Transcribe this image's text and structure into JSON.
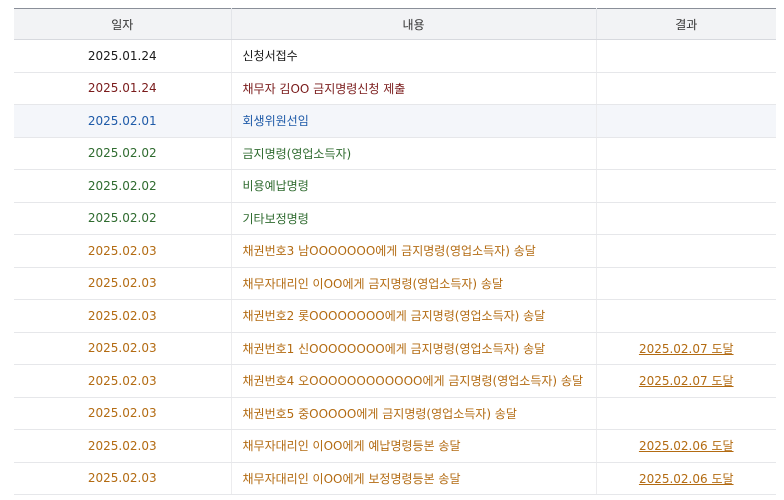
{
  "table": {
    "headers": {
      "date": "일자",
      "content": "내용",
      "result": "결과"
    },
    "rows": [
      {
        "date": "2025.01.24",
        "content": "신청서접수",
        "result": "",
        "color": "#1a1a1a"
      },
      {
        "date": "2025.01.24",
        "content": "채무자 김OO 금지명령신청 제출",
        "result": "",
        "color": "#7a1b1b"
      },
      {
        "date": "2025.02.01",
        "content": "회생위원선임",
        "result": "",
        "color": "#1e5aa8",
        "highlighted": true
      },
      {
        "date": "2025.02.02",
        "content": "금지명령(영업소득자)",
        "result": "",
        "color": "#2f6b2f"
      },
      {
        "date": "2025.02.02",
        "content": "비용예납명령",
        "result": "",
        "color": "#2f6b2f"
      },
      {
        "date": "2025.02.02",
        "content": "기타보정명령",
        "result": "",
        "color": "#2f6b2f"
      },
      {
        "date": "2025.02.03",
        "content": "채권번호3 남OOOOOOO에게 금지명령(영업소득자) 송달",
        "result": "",
        "color": "#b36b12"
      },
      {
        "date": "2025.02.03",
        "content": "채무자대리인 이OO에게 금지명령(영업소득자) 송달",
        "result": "",
        "color": "#b36b12"
      },
      {
        "date": "2025.02.03",
        "content": "채권번호2 롯OOOOOOOO에게 금지명령(영업소득자) 송달",
        "result": "",
        "color": "#b36b12"
      },
      {
        "date": "2025.02.03",
        "content": "채권번호1 신OOOOOOOO에게 금지명령(영업소득자) 송달",
        "result": "2025.02.07 도달",
        "color": "#b36b12"
      },
      {
        "date": "2025.02.03",
        "content": "채권번호4 오OOOOOOOOOOOO에게 금지명령(영업소득자) 송달",
        "result": "2025.02.07 도달",
        "color": "#b36b12"
      },
      {
        "date": "2025.02.03",
        "content": "채권번호5 중OOOOO에게 금지명령(영업소득자) 송달",
        "result": "",
        "color": "#b36b12"
      },
      {
        "date": "2025.02.03",
        "content": "채무자대리인 이OO에게 예납명령등본 송달",
        "result": "2025.02.06 도달",
        "color": "#b36b12"
      },
      {
        "date": "2025.02.03",
        "content": "채무자대리인 이OO에게 보정명령등본 송달",
        "result": "2025.02.06 도달",
        "color": "#b36b12"
      }
    ]
  }
}
